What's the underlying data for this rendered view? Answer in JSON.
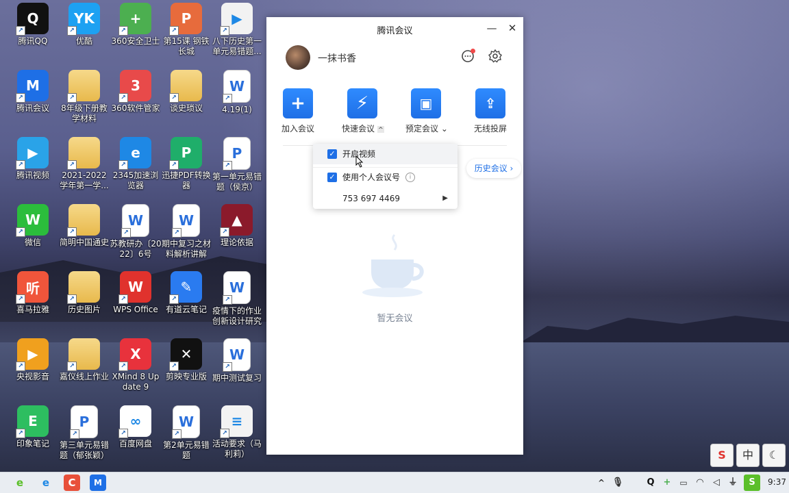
{
  "desktop": {
    "icons": [
      {
        "label": "腾讯QQ",
        "glyph": "Q",
        "color": "#111111"
      },
      {
        "label": "优酷",
        "glyph": "YK",
        "color": "#1da1f2"
      },
      {
        "label": "360安全卫士",
        "glyph": "+",
        "color": "#4caf50"
      },
      {
        "label": "第15课 钢铁长城",
        "glyph": "P",
        "color": "#e76b3c"
      },
      {
        "label": "八下历史第一单元易错题...",
        "glyph": "▶",
        "color": "#f2f2f2"
      },
      {
        "label": "腾讯会议",
        "glyph": "M",
        "color": "#1e6fe6"
      },
      {
        "label": "8年级下册教学材料",
        "glyph": "",
        "color": "folder"
      },
      {
        "label": "360软件管家",
        "glyph": "3",
        "color": "#e84a4a"
      },
      {
        "label": "谈史琐议",
        "glyph": "",
        "color": "folder"
      },
      {
        "label": "4.19(1)",
        "glyph": "W",
        "color": "doc"
      },
      {
        "label": "腾讯视频",
        "glyph": "▶",
        "color": "#2aa3e8"
      },
      {
        "label": "2021-2022学年第一学...",
        "glyph": "",
        "color": "folder"
      },
      {
        "label": "2345加速浏览器",
        "glyph": "e",
        "color": "#1e88e5"
      },
      {
        "label": "迅捷PDF转换器",
        "glyph": "P",
        "color": "#1fae6a"
      },
      {
        "label": "第一单元易错题（侯京）",
        "glyph": "P",
        "color": "doc"
      },
      {
        "label": "微信",
        "glyph": "W",
        "color": "#2bbd3c"
      },
      {
        "label": "简明中国通史",
        "glyph": "",
        "color": "folder"
      },
      {
        "label": "苏教研办〔2022〕6号",
        "glyph": "W",
        "color": "doc"
      },
      {
        "label": "期中复习之材料解析讲解",
        "glyph": "W",
        "color": "doc"
      },
      {
        "label": "理论依据",
        "glyph": "▲",
        "color": "#8b1a2b"
      },
      {
        "label": "喜马拉雅",
        "glyph": "听",
        "color": "#f0553b"
      },
      {
        "label": "历史图片",
        "glyph": "",
        "color": "folder"
      },
      {
        "label": "WPS Office",
        "glyph": "W",
        "color": "#e0322d"
      },
      {
        "label": "有道云笔记",
        "glyph": "✎",
        "color": "#2a7bf0"
      },
      {
        "label": "疫情下的作业创新设计研究",
        "glyph": "W",
        "color": "doc"
      },
      {
        "label": "央视影音",
        "glyph": "▶",
        "color": "#f0a01e"
      },
      {
        "label": "嘉仪线上作业",
        "glyph": "",
        "color": "folder"
      },
      {
        "label": "XMind 8 Update 9",
        "glyph": "X",
        "color": "#e8323c"
      },
      {
        "label": "剪映专业版",
        "glyph": "✕",
        "color": "#111111"
      },
      {
        "label": "期中测试复习",
        "glyph": "W",
        "color": "doc"
      },
      {
        "label": "印象笔记",
        "glyph": "E",
        "color": "#2dbe60"
      },
      {
        "label": "第三单元易错题（郁张颖）",
        "glyph": "P",
        "color": "doc"
      },
      {
        "label": "百度网盘",
        "glyph": "∞",
        "color": "#ffffff"
      },
      {
        "label": "第2单元易错题",
        "glyph": "W",
        "color": "doc"
      },
      {
        "label": "活动要求（马利莉）",
        "glyph": "≡",
        "color": "#f3f3f3"
      }
    ]
  },
  "window": {
    "title": "腾讯会议",
    "minimize": "—",
    "close": "✕",
    "user_name": "一抹书香",
    "actions": [
      {
        "label": "加入会议",
        "glyph": "+"
      },
      {
        "label": "快速会议",
        "glyph": "⚡",
        "suffix": "^"
      },
      {
        "label": "预定会议",
        "glyph": "▣",
        "suffix": "⌄"
      },
      {
        "label": "无线投屏",
        "glyph": "⇪"
      }
    ],
    "history_button": "历史会议 ›",
    "empty_text": "暂无会议"
  },
  "menu": {
    "item1": "开启视频",
    "item2": "使用个人会议号",
    "meeting_id": "753 697 4469",
    "info": "i",
    "arrow": "▶"
  },
  "taskbar": {
    "clock": "9:37",
    "ime": [
      "S",
      "中",
      "☾"
    ]
  }
}
